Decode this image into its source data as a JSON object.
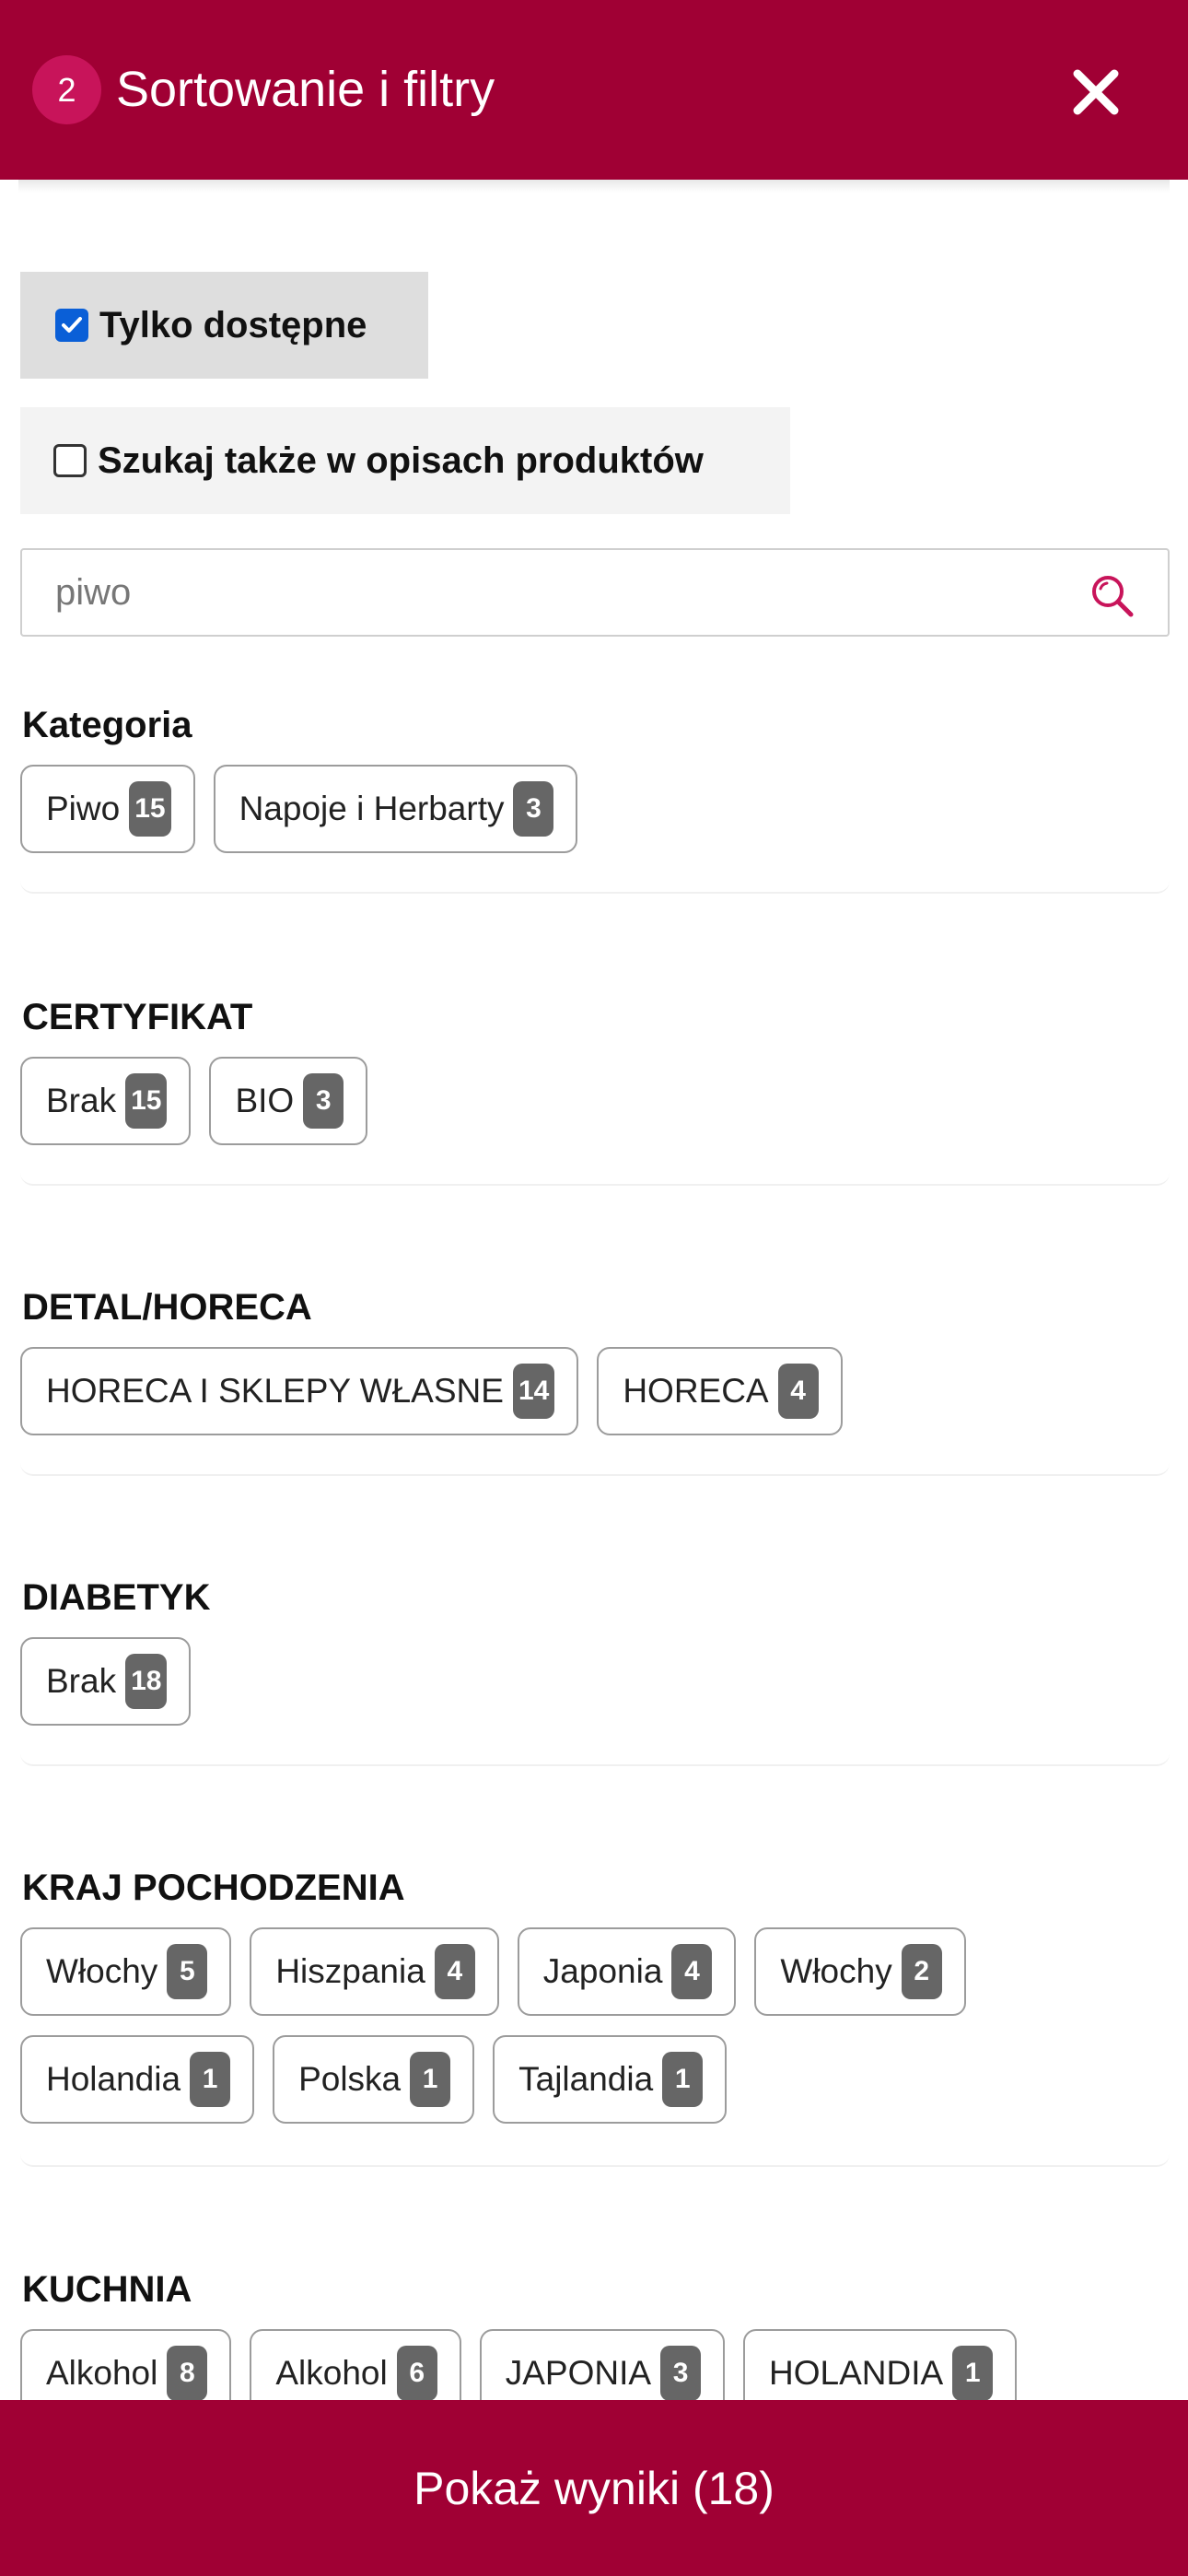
{
  "header": {
    "step": "2",
    "title": "Sortowanie i filtry"
  },
  "options": {
    "available_only": "Tylko dostępne",
    "search_descriptions": "Szukaj także w opisach produktów"
  },
  "search": {
    "value": "piwo",
    "placeholder": "piwo"
  },
  "sections": [
    {
      "title": "Kategoria",
      "chips": [
        {
          "label": "Piwo",
          "count": "15"
        },
        {
          "label": "Napoje i Herbarty",
          "count": "3"
        }
      ]
    },
    {
      "title": "CERTYFIKAT",
      "chips": [
        {
          "label": "Brak",
          "count": "15"
        },
        {
          "label": "BIO",
          "count": "3"
        }
      ]
    },
    {
      "title": "DETAL/HORECA",
      "chips": [
        {
          "label": "HORECA I SKLEPY WŁASNE",
          "count": "14"
        },
        {
          "label": "HORECA",
          "count": "4"
        }
      ]
    },
    {
      "title": "DIABETYK",
      "chips": [
        {
          "label": "Brak",
          "count": "18"
        }
      ]
    },
    {
      "title": "KRAJ POCHODZENIA",
      "chips": [
        {
          "label": "Włochy",
          "count": "5"
        },
        {
          "label": "Hiszpania",
          "count": "4"
        },
        {
          "label": "Japonia",
          "count": "4"
        },
        {
          "label": "Włochy",
          "count": "2"
        },
        {
          "label": "Holandia",
          "count": "1"
        },
        {
          "label": "Polska",
          "count": "1"
        },
        {
          "label": "Tajlandia",
          "count": "1"
        }
      ]
    },
    {
      "title": "KUCHNIA",
      "chips": [
        {
          "label": "Alkohol",
          "count": "8"
        },
        {
          "label": "Alkohol",
          "count": "6"
        },
        {
          "label": "JAPONIA",
          "count": "3"
        },
        {
          "label": "HOLANDIA",
          "count": "1"
        }
      ]
    }
  ],
  "footer": {
    "show_results": "Pokaż wyniki (18)"
  },
  "colors": {
    "brand": "#a00034",
    "badge": "#c8145a",
    "count_bg": "#666666",
    "checkbox": "#0a5fd7"
  }
}
